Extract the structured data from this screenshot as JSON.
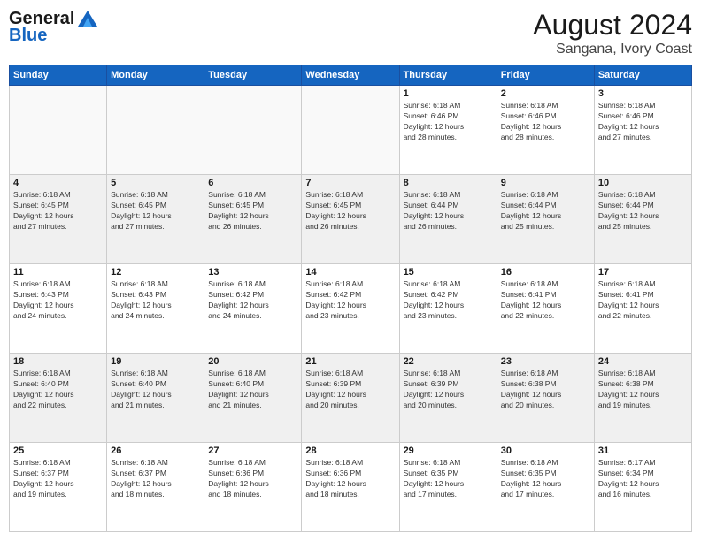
{
  "header": {
    "logo_general": "General",
    "logo_blue": "Blue",
    "month_year": "August 2024",
    "location": "Sangana, Ivory Coast"
  },
  "weekdays": [
    "Sunday",
    "Monday",
    "Tuesday",
    "Wednesday",
    "Thursday",
    "Friday",
    "Saturday"
  ],
  "weeks": [
    [
      {
        "day": "",
        "info": "",
        "empty": true
      },
      {
        "day": "",
        "info": "",
        "empty": true
      },
      {
        "day": "",
        "info": "",
        "empty": true
      },
      {
        "day": "",
        "info": "",
        "empty": true
      },
      {
        "day": "1",
        "info": "Sunrise: 6:18 AM\nSunset: 6:46 PM\nDaylight: 12 hours\nand 28 minutes.",
        "empty": false
      },
      {
        "day": "2",
        "info": "Sunrise: 6:18 AM\nSunset: 6:46 PM\nDaylight: 12 hours\nand 28 minutes.",
        "empty": false
      },
      {
        "day": "3",
        "info": "Sunrise: 6:18 AM\nSunset: 6:46 PM\nDaylight: 12 hours\nand 27 minutes.",
        "empty": false
      }
    ],
    [
      {
        "day": "4",
        "info": "Sunrise: 6:18 AM\nSunset: 6:45 PM\nDaylight: 12 hours\nand 27 minutes.",
        "empty": false
      },
      {
        "day": "5",
        "info": "Sunrise: 6:18 AM\nSunset: 6:45 PM\nDaylight: 12 hours\nand 27 minutes.",
        "empty": false
      },
      {
        "day": "6",
        "info": "Sunrise: 6:18 AM\nSunset: 6:45 PM\nDaylight: 12 hours\nand 26 minutes.",
        "empty": false
      },
      {
        "day": "7",
        "info": "Sunrise: 6:18 AM\nSunset: 6:45 PM\nDaylight: 12 hours\nand 26 minutes.",
        "empty": false
      },
      {
        "day": "8",
        "info": "Sunrise: 6:18 AM\nSunset: 6:44 PM\nDaylight: 12 hours\nand 26 minutes.",
        "empty": false
      },
      {
        "day": "9",
        "info": "Sunrise: 6:18 AM\nSunset: 6:44 PM\nDaylight: 12 hours\nand 25 minutes.",
        "empty": false
      },
      {
        "day": "10",
        "info": "Sunrise: 6:18 AM\nSunset: 6:44 PM\nDaylight: 12 hours\nand 25 minutes.",
        "empty": false
      }
    ],
    [
      {
        "day": "11",
        "info": "Sunrise: 6:18 AM\nSunset: 6:43 PM\nDaylight: 12 hours\nand 24 minutes.",
        "empty": false
      },
      {
        "day": "12",
        "info": "Sunrise: 6:18 AM\nSunset: 6:43 PM\nDaylight: 12 hours\nand 24 minutes.",
        "empty": false
      },
      {
        "day": "13",
        "info": "Sunrise: 6:18 AM\nSunset: 6:42 PM\nDaylight: 12 hours\nand 24 minutes.",
        "empty": false
      },
      {
        "day": "14",
        "info": "Sunrise: 6:18 AM\nSunset: 6:42 PM\nDaylight: 12 hours\nand 23 minutes.",
        "empty": false
      },
      {
        "day": "15",
        "info": "Sunrise: 6:18 AM\nSunset: 6:42 PM\nDaylight: 12 hours\nand 23 minutes.",
        "empty": false
      },
      {
        "day": "16",
        "info": "Sunrise: 6:18 AM\nSunset: 6:41 PM\nDaylight: 12 hours\nand 22 minutes.",
        "empty": false
      },
      {
        "day": "17",
        "info": "Sunrise: 6:18 AM\nSunset: 6:41 PM\nDaylight: 12 hours\nand 22 minutes.",
        "empty": false
      }
    ],
    [
      {
        "day": "18",
        "info": "Sunrise: 6:18 AM\nSunset: 6:40 PM\nDaylight: 12 hours\nand 22 minutes.",
        "empty": false
      },
      {
        "day": "19",
        "info": "Sunrise: 6:18 AM\nSunset: 6:40 PM\nDaylight: 12 hours\nand 21 minutes.",
        "empty": false
      },
      {
        "day": "20",
        "info": "Sunrise: 6:18 AM\nSunset: 6:40 PM\nDaylight: 12 hours\nand 21 minutes.",
        "empty": false
      },
      {
        "day": "21",
        "info": "Sunrise: 6:18 AM\nSunset: 6:39 PM\nDaylight: 12 hours\nand 20 minutes.",
        "empty": false
      },
      {
        "day": "22",
        "info": "Sunrise: 6:18 AM\nSunset: 6:39 PM\nDaylight: 12 hours\nand 20 minutes.",
        "empty": false
      },
      {
        "day": "23",
        "info": "Sunrise: 6:18 AM\nSunset: 6:38 PM\nDaylight: 12 hours\nand 20 minutes.",
        "empty": false
      },
      {
        "day": "24",
        "info": "Sunrise: 6:18 AM\nSunset: 6:38 PM\nDaylight: 12 hours\nand 19 minutes.",
        "empty": false
      }
    ],
    [
      {
        "day": "25",
        "info": "Sunrise: 6:18 AM\nSunset: 6:37 PM\nDaylight: 12 hours\nand 19 minutes.",
        "empty": false
      },
      {
        "day": "26",
        "info": "Sunrise: 6:18 AM\nSunset: 6:37 PM\nDaylight: 12 hours\nand 18 minutes.",
        "empty": false
      },
      {
        "day": "27",
        "info": "Sunrise: 6:18 AM\nSunset: 6:36 PM\nDaylight: 12 hours\nand 18 minutes.",
        "empty": false
      },
      {
        "day": "28",
        "info": "Sunrise: 6:18 AM\nSunset: 6:36 PM\nDaylight: 12 hours\nand 18 minutes.",
        "empty": false
      },
      {
        "day": "29",
        "info": "Sunrise: 6:18 AM\nSunset: 6:35 PM\nDaylight: 12 hours\nand 17 minutes.",
        "empty": false
      },
      {
        "day": "30",
        "info": "Sunrise: 6:18 AM\nSunset: 6:35 PM\nDaylight: 12 hours\nand 17 minutes.",
        "empty": false
      },
      {
        "day": "31",
        "info": "Sunrise: 6:17 AM\nSunset: 6:34 PM\nDaylight: 12 hours\nand 16 minutes.",
        "empty": false
      }
    ]
  ]
}
